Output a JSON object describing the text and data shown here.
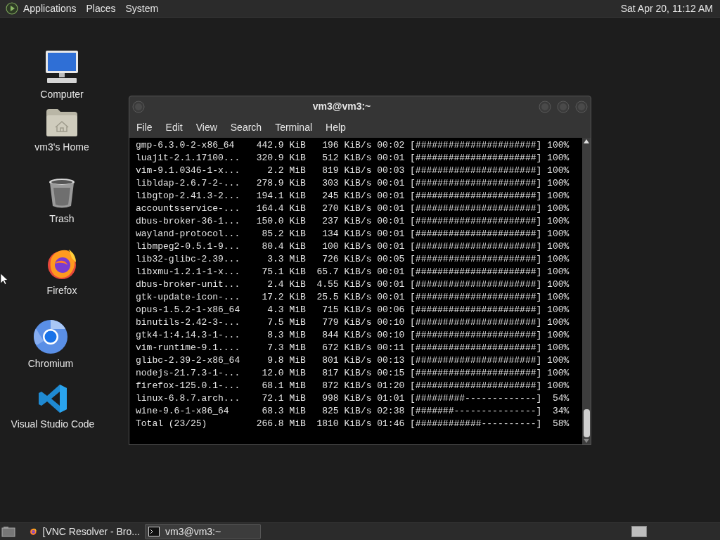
{
  "top_panel": {
    "menus": [
      "Applications",
      "Places",
      "System"
    ],
    "clock": "Sat Apr 20, 11:12 AM"
  },
  "desktop_icons": [
    {
      "label": "Computer",
      "kind": "computer"
    },
    {
      "label": "vm3's Home",
      "kind": "home"
    },
    {
      "label": "Trash",
      "kind": "trash"
    },
    {
      "label": "Firefox",
      "kind": "firefox"
    },
    {
      "label": "Chromium",
      "kind": "chromium"
    },
    {
      "label": "Visual Studio Code",
      "kind": "vscode"
    }
  ],
  "terminal": {
    "title": "vm3@vm3:~",
    "menu": [
      "File",
      "Edit",
      "View",
      "Search",
      "Terminal",
      "Help"
    ],
    "lines": [
      "gmp-6.3.0-2-x86_64    442.9 KiB   196 KiB/s 00:02 [######################] 100%",
      "luajit-2.1.17100...   320.9 KiB   512 KiB/s 00:01 [######################] 100%",
      "vim-9.1.0346-1-x...     2.2 MiB   819 KiB/s 00:03 [######################] 100%",
      "libldap-2.6.7-2-...   278.9 KiB   303 KiB/s 00:01 [######################] 100%",
      "libgtop-2.41.3-2...   194.1 KiB   245 KiB/s 00:01 [######################] 100%",
      "accountsservice-...   164.4 KiB   270 KiB/s 00:01 [######################] 100%",
      "dbus-broker-36-1...   150.0 KiB   237 KiB/s 00:01 [######################] 100%",
      "wayland-protocol...    85.2 KiB   134 KiB/s 00:01 [######################] 100%",
      "libmpeg2-0.5.1-9...    80.4 KiB   100 KiB/s 00:01 [######################] 100%",
      "lib32-glibc-2.39...     3.3 MiB   726 KiB/s 00:05 [######################] 100%",
      "libxmu-1.2.1-1-x...    75.1 KiB  65.7 KiB/s 00:01 [######################] 100%",
      "dbus-broker-unit...     2.4 KiB  4.55 KiB/s 00:01 [######################] 100%",
      "gtk-update-icon-...    17.2 KiB  25.5 KiB/s 00:01 [######################] 100%",
      "opus-1.5.2-1-x86_64     4.3 MiB   715 KiB/s 00:06 [######################] 100%",
      "binutils-2.42-3-...     7.5 MiB   779 KiB/s 00:10 [######################] 100%",
      "gtk4-1:4.14.3-1-...     8.3 MiB   844 KiB/s 00:10 [######################] 100%",
      "vim-runtime-9.1....     7.3 MiB   672 KiB/s 00:11 [######################] 100%",
      "glibc-2.39-2-x86_64     9.8 MiB   801 KiB/s 00:13 [######################] 100%",
      "nodejs-21.7.3-1-...    12.0 MiB   817 KiB/s 00:15 [######################] 100%",
      "firefox-125.0.1-...    68.1 MiB   872 KiB/s 01:20 [######################] 100%",
      "linux-6.8.7.arch...    72.1 MiB   998 KiB/s 01:01 [#########-------------]  54%",
      "wine-9.6-1-x86_64      68.3 MiB   825 KiB/s 02:38 [#######---------------]  34%",
      "Total (23/25)         266.8 MiB  1810 KiB/s 01:46 [############----------]  58%"
    ]
  },
  "taskbar": {
    "tasks": [
      {
        "label": "[VNC Resolver - Bro...",
        "kind": "browser",
        "selected": false
      },
      {
        "label": "vm3@vm3:~",
        "kind": "terminal",
        "selected": true
      }
    ]
  }
}
